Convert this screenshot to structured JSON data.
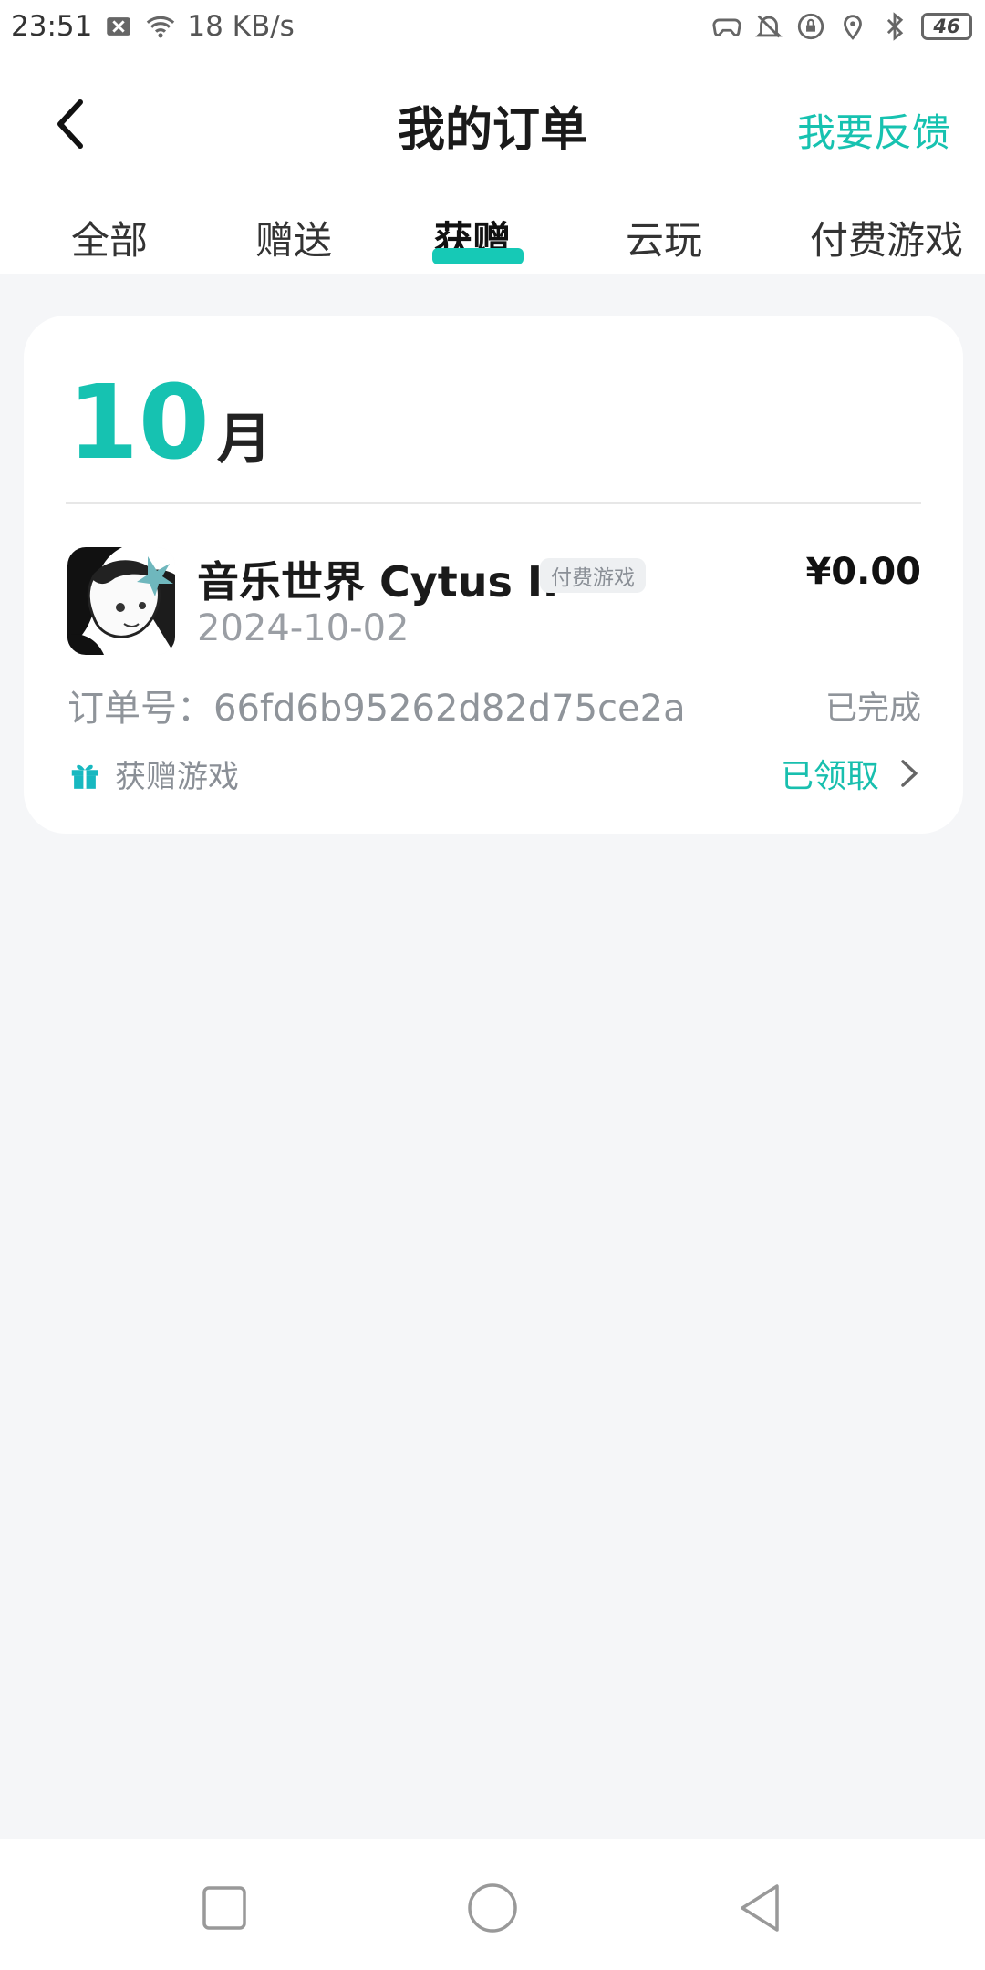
{
  "status_bar": {
    "time": "23:51",
    "net_speed": "18 KB/s",
    "battery": "46",
    "icons": [
      "close-box-icon",
      "wifi-icon",
      "gamepad-icon",
      "bell-off-icon",
      "lock-rotation-icon",
      "location-icon",
      "bluetooth-icon",
      "battery-icon"
    ]
  },
  "header": {
    "title": "我的订单",
    "feedback": "我要反馈"
  },
  "tabs": {
    "all": "全部",
    "gift_sent": "赠送",
    "gift_received": "获赠",
    "cloud_play": "云玩",
    "paid_games": "付费游戏",
    "active": "获赠"
  },
  "section": {
    "month_number": "10",
    "month_unit": "月"
  },
  "order": {
    "game_name": "音乐世界 Cytus II",
    "tag": "付费游戏",
    "price": "¥0.00",
    "date": "2024-10-02",
    "order_no": "订单号：66fd6b95262d82d75ce2a",
    "status": "已完成",
    "gift_label": "获赠游戏",
    "action": "已领取"
  },
  "colors": {
    "accent": "#16c2b1",
    "background": "#f5f6f8"
  }
}
